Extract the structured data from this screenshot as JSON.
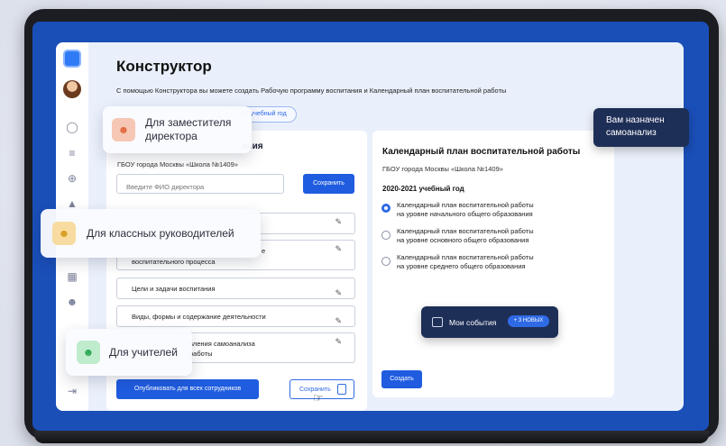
{
  "colors": {
    "screen_bg": "#1a4fb8",
    "app_bg": "#eaf0fb",
    "accent": "#1f5ce0",
    "dark_pill": "#1e2f57",
    "deputy_icon": "#f6c7b4",
    "class_icon": "#f8dba0",
    "teacher_icon": "#bfeccc"
  },
  "sidebar": {
    "icons": [
      "lightbulb-icon",
      "stack-icon",
      "globe-icon",
      "graduation-cap-icon",
      "calendar-icon",
      "users-icon",
      "logout-icon"
    ]
  },
  "header": {
    "title": "Конструктор",
    "description": "С помощью Конструктора вы можете создать Рабочую программу воспитания и Календарный план воспитательной работы",
    "year_chip": "22 учебный год"
  },
  "left_card": {
    "title_fragment": "ания",
    "school": "ГБОУ города Москвы «Школа №1409»",
    "fio_placeholder": "Введите ФИО директора",
    "save_label": "Сохранить",
    "items": [
      {
        "label": ""
      },
      {
        "label": "воспитательного процесса",
        "label_top": "е"
      },
      {
        "label": "Цели и задачи воспитания"
      },
      {
        "label": "Виды, формы и содержание деятельности"
      },
      {
        "label": "вления самоанализа",
        "label_bottom": "работы"
      }
    ],
    "publish_label": "Опубликовать для всех сотрудников",
    "save2_label": "Сохранить"
  },
  "right_card": {
    "title": "Календарный план воспитательной работы",
    "school": "ГБОУ города Москвы «Школа №1409»",
    "year": "2020-2021 учебный год",
    "options": [
      {
        "line1": "Календарный план воспитательной работы",
        "line2": "на уровне начального общего образования",
        "selected": true
      },
      {
        "line1": "Календарный план воспитательной работы",
        "line2": "на уровне основного общего образования",
        "selected": false
      },
      {
        "line1": "Календарный план воспитательной работы",
        "line2": "на уровне среднего общего образования",
        "selected": false
      }
    ],
    "create_label": "Создать"
  },
  "events": {
    "label": "Мои события",
    "badge": "+ 3 НОВЫХ"
  },
  "self_analysis": {
    "line1": "Вам назначен",
    "line2": "самоанализ"
  },
  "floating": {
    "deputy": {
      "line1": "Для заместителя",
      "line2": "директора"
    },
    "class_leaders": "Для классных руководителей",
    "teachers": "Для учителей"
  }
}
